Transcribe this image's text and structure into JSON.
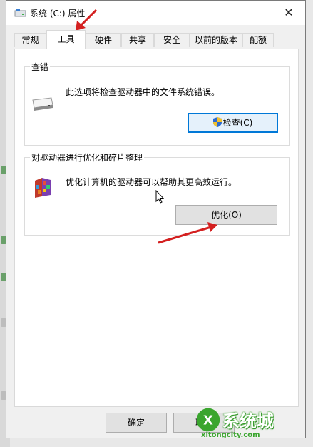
{
  "window": {
    "title": "系统 (C:) 属性",
    "close_symbol": "✕",
    "tabs": [
      "常规",
      "工具",
      "硬件",
      "共享",
      "安全",
      "以前的版本",
      "配额"
    ],
    "active_tab": "工具"
  },
  "error_check": {
    "group_label": "查错",
    "description": "此选项将检查驱动器中的文件系统错误。",
    "button_label": "检查(C)",
    "icon": "drive-icon"
  },
  "optimize": {
    "group_label": "对驱动器进行优化和碎片整理",
    "description": "优化计算机的驱动器可以帮助其更高效运行。",
    "button_label": "优化(O)",
    "icon": "defrag-icon"
  },
  "footer": {
    "ok_label": "确定",
    "cancel_label": "取"
  },
  "watermark": {
    "brand": "系统城",
    "url": "xitongcity.com"
  },
  "colors": {
    "focus_border": "#0078d7",
    "annotation_arrow": "#d42020",
    "watermark_green": "#3aa52e"
  }
}
